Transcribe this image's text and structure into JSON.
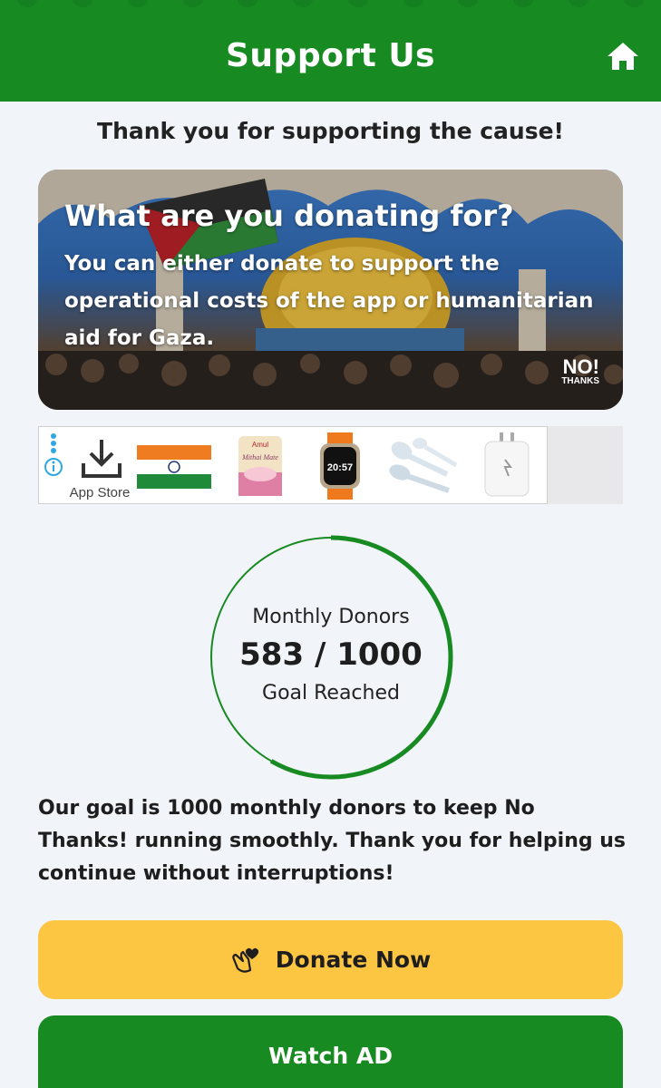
{
  "header": {
    "title": "Support Us",
    "home_icon": "home-icon"
  },
  "intro": "Thank you for supporting the cause!",
  "banner": {
    "title": "What are you donating for?",
    "body": "You can either donate to support the operational costs of the app or humanitarian aid for Gaza.",
    "logo_top": "NO!",
    "logo_bottom": "THANKS"
  },
  "ad": {
    "app_store_label": "App Store",
    "watch_time": "20:57",
    "product_brand": "Amul",
    "product_name": "Mithai Mate"
  },
  "progress": {
    "label": "Monthly Donors",
    "current": 583,
    "goal": 1000,
    "value_text": "583 / 1000",
    "sub": "Goal Reached",
    "color": "#178a22"
  },
  "goal_text": "Our goal is 1000 monthly donors to keep No Thanks! running smoothly. Thank you for helping us continue without interruptions!",
  "buttons": {
    "donate_label": "Donate Now",
    "donate_icon": "hand-heart-icon",
    "watch_label": "Watch AD"
  },
  "colors": {
    "brand_green": "#178a22",
    "donate_yellow": "#fcc643",
    "background": "#f1f4f8"
  }
}
